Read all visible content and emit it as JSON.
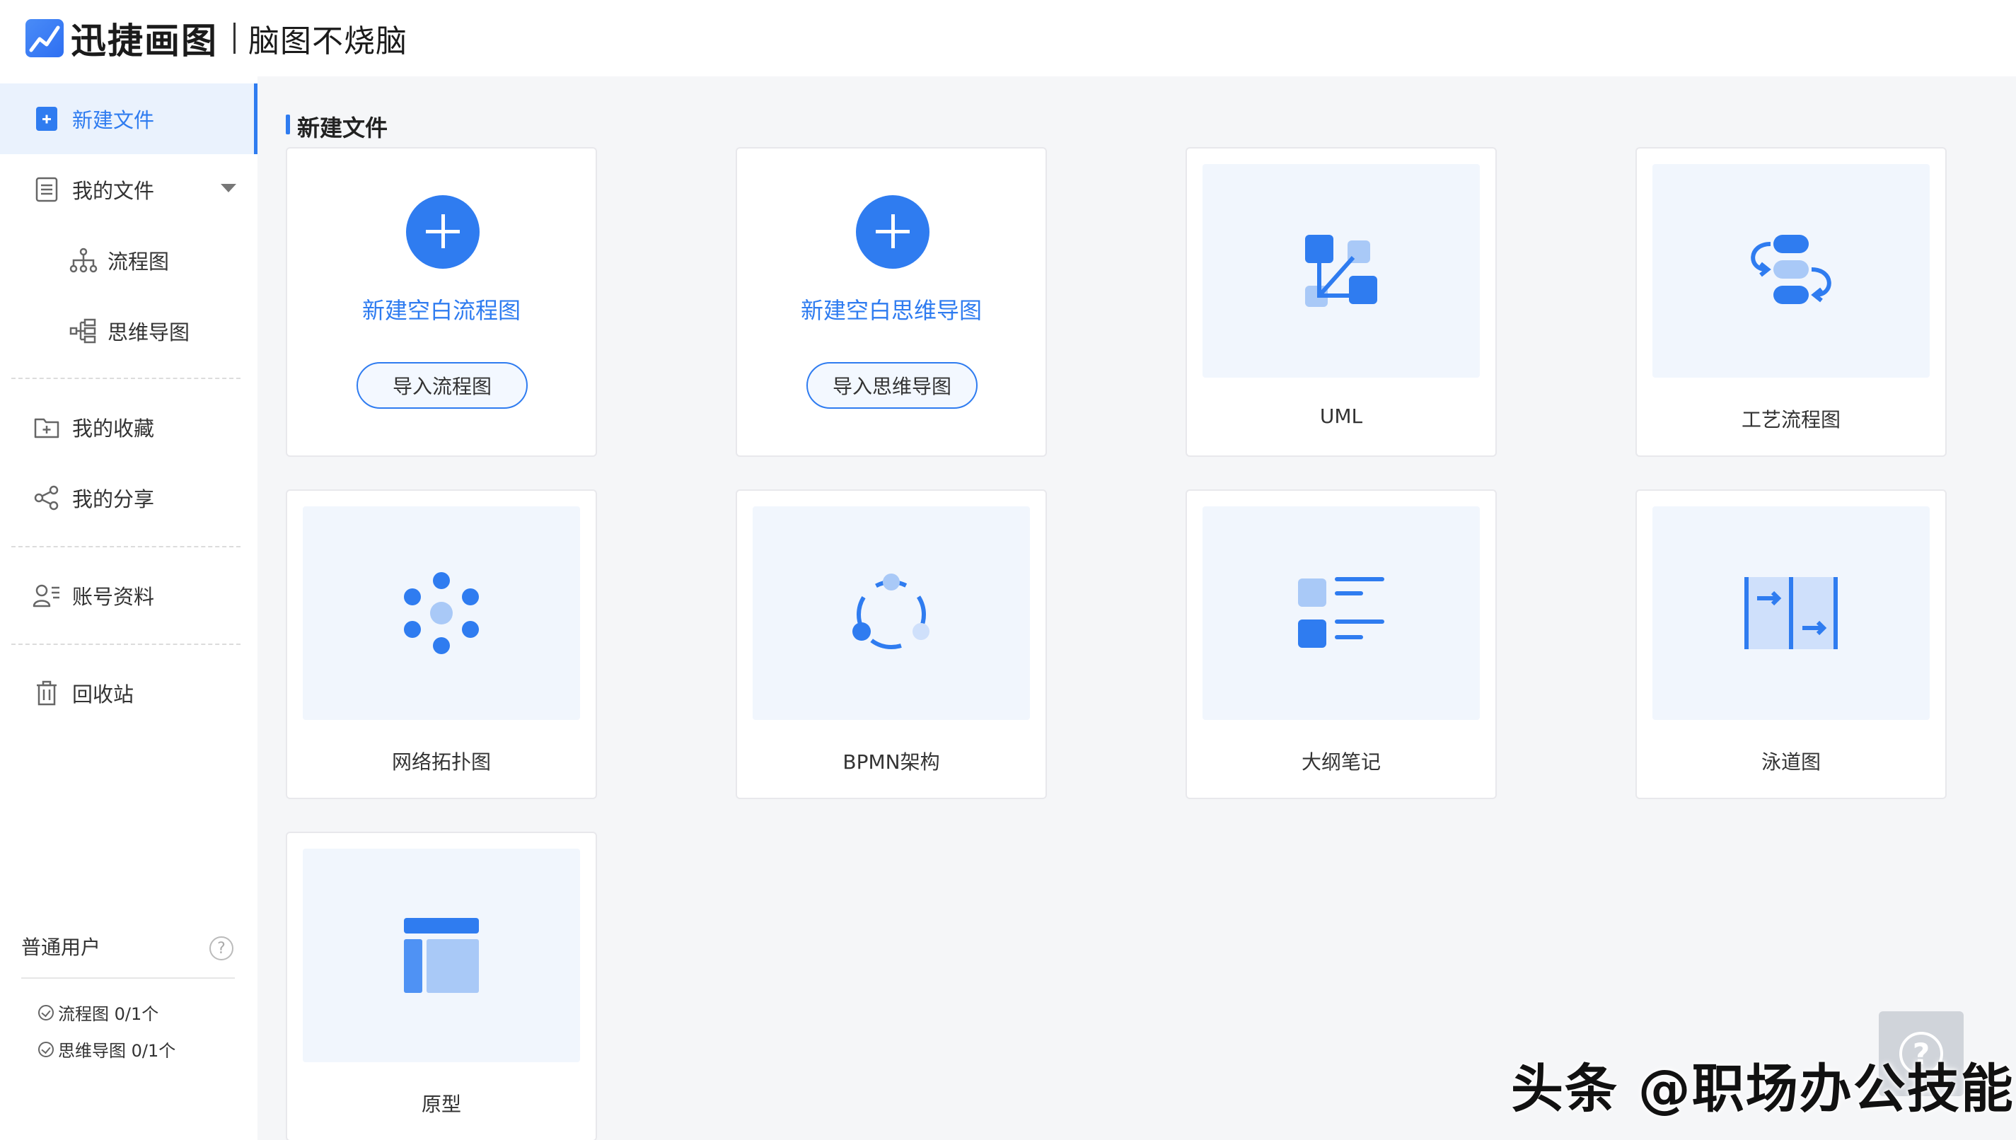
{
  "header": {
    "app_name": "迅捷画图",
    "slogan": "脑图不烧脑"
  },
  "sidebar": {
    "items": [
      {
        "label": "新建文件",
        "icon": "new-file-icon"
      },
      {
        "label": "我的文件",
        "icon": "document-icon"
      },
      {
        "label": "流程图",
        "icon": "hierarchy-icon"
      },
      {
        "label": "思维导图",
        "icon": "mindmap-icon"
      },
      {
        "label": "我的收藏",
        "icon": "folder-plus-icon"
      },
      {
        "label": "我的分享",
        "icon": "share-icon"
      },
      {
        "label": "账号资料",
        "icon": "user-profile-icon"
      },
      {
        "label": "回收站",
        "icon": "trash-icon"
      }
    ],
    "user_type": "普通用户",
    "quota": [
      {
        "label": "流程图 0/1个"
      },
      {
        "label": "思维导图 0/1个"
      }
    ]
  },
  "main": {
    "section_title": "新建文件",
    "blank_cards": [
      {
        "label": "新建空白流程图",
        "import_label": "导入流程图"
      },
      {
        "label": "新建空白思维导图",
        "import_label": "导入思维导图"
      }
    ],
    "templates": [
      {
        "label": "UML",
        "icon": "uml-icon"
      },
      {
        "label": "工艺流程图",
        "icon": "process-flow-icon"
      },
      {
        "label": "网络拓扑图",
        "icon": "network-topology-icon"
      },
      {
        "label": "BPMN架构",
        "icon": "bpmn-icon"
      },
      {
        "label": "大纲笔记",
        "icon": "outline-notes-icon"
      },
      {
        "label": "泳道图",
        "icon": "swimlane-icon"
      },
      {
        "label": "原型",
        "icon": "prototype-icon"
      }
    ]
  },
  "float_help": {
    "label": "?"
  },
  "watermark": "头条 @职场办公技能",
  "colors": {
    "accent": "#2f7cf0",
    "light_accent": "#a9c9f7",
    "background": "#f5f6f8",
    "thumb_bg": "#f1f6fd"
  }
}
